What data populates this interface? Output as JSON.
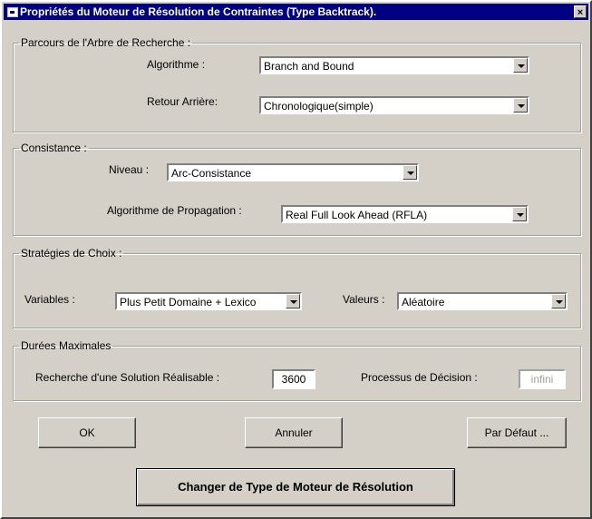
{
  "window": {
    "title": "Propriétés du Moteur de Résolution de Contraintes (Type Backtrack).",
    "close_glyph": "×"
  },
  "search_tree": {
    "legend": "Parcours de l'Arbre de Recherche :",
    "algorithm_label": "Algorithme :",
    "algorithm_value": "Branch and Bound",
    "backtrack_label": "Retour Arrière:",
    "backtrack_value": "Chronologique(simple)"
  },
  "consistency": {
    "legend": "Consistance :",
    "level_label": "Niveau :",
    "level_value": "Arc-Consistance",
    "propagation_label": "Algorithme de Propagation :",
    "propagation_value": "Real Full Look Ahead (RFLA)"
  },
  "choice_strategies": {
    "legend": "Stratégies de Choix :",
    "variables_label": "Variables :",
    "variables_value": "Plus Petit Domaine + Lexico",
    "values_label": "Valeurs :",
    "values_value": "Aléatoire"
  },
  "max_durations": {
    "legend": "Durées Maximales",
    "feasible_label": "Recherche d'une Solution Réalisable :",
    "feasible_value": "3600",
    "decision_label": "Processus de Décision :",
    "decision_value": "infini"
  },
  "buttons": {
    "ok": "OK",
    "cancel": "Annuler",
    "default": "Par Défaut ...",
    "change_engine": "Changer de Type de Moteur de Résolution"
  }
}
